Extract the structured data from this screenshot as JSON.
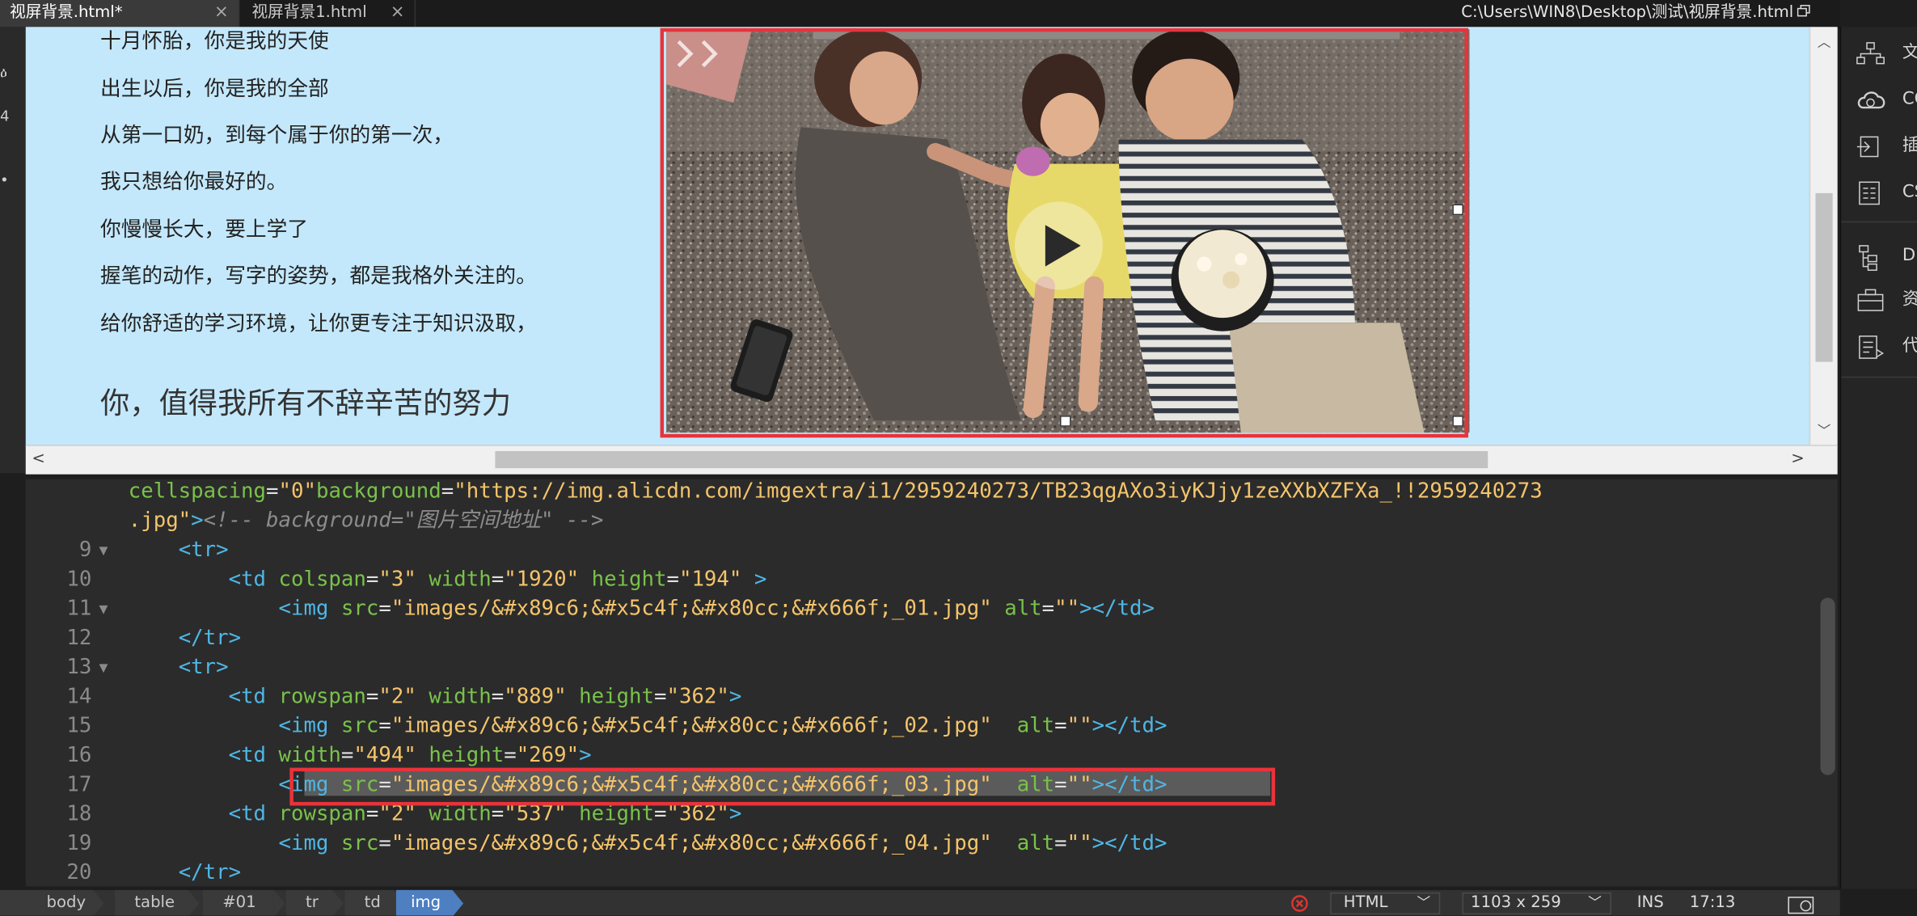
{
  "tabs": [
    {
      "label": "视屏背景.html*",
      "close": "×"
    },
    {
      "label": "视屏背景1.html",
      "close": "×"
    }
  ],
  "file_path": "C:\\Users\\WIN8\\Desktop\\测试\\视屏背景.html",
  "left_strip": {
    "glyphs": [
      "ዕ",
      "4",
      "•"
    ]
  },
  "design": {
    "poem_lines": [
      "十月怀胎，你是我的天使",
      "出生以后，你是我的全部",
      "从第一口奶，到每个属于你的第一次，",
      "我只想给你最好的。",
      "你慢慢长大，要上学了",
      "握笔的动作，写字的姿势，都是我格外关注的。",
      "给你舒适的学习环境，让你更专注于知识汲取，"
    ],
    "headline": "你，值得我所有不辞辛苦的努力",
    "image": {
      "subject": "family-on-sofa-photo",
      "play_icon": "play-icon"
    }
  },
  "right_panel": {
    "items": [
      {
        "label": "文",
        "icon": "files-tree-icon"
      },
      {
        "label": "CC",
        "icon": "creative-cloud-icon"
      },
      {
        "label": "插",
        "icon": "insert-icon"
      },
      {
        "label": "CS",
        "icon": "css-designer-icon"
      },
      {
        "label": "D",
        "icon": "dom-icon"
      },
      {
        "label": "资",
        "icon": "assets-icon"
      },
      {
        "label": "代",
        "icon": "snippets-icon"
      }
    ]
  },
  "code": {
    "lines": [
      {
        "num": "",
        "fold": false,
        "segments": [
          [
            "attr",
            "cellspacing"
          ],
          [
            "txt",
            "="
          ],
          [
            "val",
            "\"0\""
          ],
          [
            "attr",
            "background"
          ],
          [
            "txt",
            "="
          ],
          [
            "val",
            "\"https://img.alicdn.com/imgextra/i1/2959240273/TB23qgAXo3iyKJjy1zeXXbXZFXa_!!2959240273"
          ]
        ]
      },
      {
        "num": "",
        "fold": false,
        "segments": [
          [
            "val",
            ".jpg\""
          ],
          [
            "tag",
            ">"
          ],
          [
            "cmt",
            "<!-- background=\"图片空间地址\" -->"
          ]
        ]
      },
      {
        "num": "9",
        "fold": true,
        "segments": [
          [
            "txt",
            "    "
          ],
          [
            "tag",
            "<tr>"
          ]
        ]
      },
      {
        "num": "10",
        "fold": false,
        "segments": [
          [
            "txt",
            "        "
          ],
          [
            "tag",
            "<td "
          ],
          [
            "attr",
            "colspan"
          ],
          [
            "txt",
            "="
          ],
          [
            "val",
            "\"3\""
          ],
          [
            "txt",
            " "
          ],
          [
            "attr",
            "width"
          ],
          [
            "txt",
            "="
          ],
          [
            "val",
            "\"1920\""
          ],
          [
            "txt",
            " "
          ],
          [
            "attr",
            "height"
          ],
          [
            "txt",
            "="
          ],
          [
            "val",
            "\"194\""
          ],
          [
            "txt",
            " "
          ],
          [
            "tag",
            ">"
          ]
        ]
      },
      {
        "num": "11",
        "fold": true,
        "segments": [
          [
            "txt",
            "            "
          ],
          [
            "tag",
            "<img "
          ],
          [
            "attr",
            "src"
          ],
          [
            "txt",
            "="
          ],
          [
            "val",
            "\"images/&#x89c6;&#x5c4f;&#x80cc;&#x666f;_01.jpg\""
          ],
          [
            "txt",
            " "
          ],
          [
            "attr",
            "alt"
          ],
          [
            "txt",
            "="
          ],
          [
            "val",
            "\"\""
          ],
          [
            "tag",
            "></td>"
          ]
        ]
      },
      {
        "num": "12",
        "fold": false,
        "segments": [
          [
            "txt",
            "    "
          ],
          [
            "tag",
            "</tr>"
          ]
        ]
      },
      {
        "num": "13",
        "fold": true,
        "segments": [
          [
            "txt",
            "    "
          ],
          [
            "tag",
            "<tr>"
          ]
        ]
      },
      {
        "num": "14",
        "fold": false,
        "segments": [
          [
            "txt",
            "        "
          ],
          [
            "tag",
            "<td "
          ],
          [
            "attr",
            "rowspan"
          ],
          [
            "txt",
            "="
          ],
          [
            "val",
            "\"2\""
          ],
          [
            "txt",
            " "
          ],
          [
            "attr",
            "width"
          ],
          [
            "txt",
            "="
          ],
          [
            "val",
            "\"889\""
          ],
          [
            "txt",
            " "
          ],
          [
            "attr",
            "height"
          ],
          [
            "txt",
            "="
          ],
          [
            "val",
            "\"362\""
          ],
          [
            "tag",
            ">"
          ]
        ]
      },
      {
        "num": "15",
        "fold": false,
        "segments": [
          [
            "txt",
            "            "
          ],
          [
            "tag",
            "<img "
          ],
          [
            "attr",
            "src"
          ],
          [
            "txt",
            "="
          ],
          [
            "val",
            "\"images/&#x89c6;&#x5c4f;&#x80cc;&#x666f;_02.jpg\""
          ],
          [
            "txt",
            "  "
          ],
          [
            "attr",
            "alt"
          ],
          [
            "txt",
            "="
          ],
          [
            "val",
            "\"\""
          ],
          [
            "tag",
            "></td>"
          ]
        ]
      },
      {
        "num": "16",
        "fold": false,
        "segments": [
          [
            "txt",
            "        "
          ],
          [
            "tag",
            "<td "
          ],
          [
            "attr",
            "width"
          ],
          [
            "txt",
            "="
          ],
          [
            "val",
            "\"494\""
          ],
          [
            "txt",
            " "
          ],
          [
            "attr",
            "height"
          ],
          [
            "txt",
            "="
          ],
          [
            "val",
            "\"269\""
          ],
          [
            "tag",
            ">"
          ]
        ]
      },
      {
        "num": "17",
        "fold": false,
        "segments": [
          [
            "txt",
            "            "
          ],
          [
            "tag",
            "<img "
          ],
          [
            "attr",
            "src"
          ],
          [
            "txt",
            "="
          ],
          [
            "val",
            "\"images/&#x89c6;&#x5c4f;&#x80cc;&#x666f;_03.jpg\""
          ],
          [
            "txt",
            "  "
          ],
          [
            "attr",
            "alt"
          ],
          [
            "txt",
            "="
          ],
          [
            "val",
            "\"\""
          ],
          [
            "tag",
            "></td>"
          ]
        ]
      },
      {
        "num": "18",
        "fold": false,
        "segments": [
          [
            "txt",
            "        "
          ],
          [
            "tag",
            "<td "
          ],
          [
            "attr",
            "rowspan"
          ],
          [
            "txt",
            "="
          ],
          [
            "val",
            "\"2\""
          ],
          [
            "txt",
            " "
          ],
          [
            "attr",
            "width"
          ],
          [
            "txt",
            "="
          ],
          [
            "val",
            "\"537\""
          ],
          [
            "txt",
            " "
          ],
          [
            "attr",
            "height"
          ],
          [
            "txt",
            "="
          ],
          [
            "val",
            "\"362\""
          ],
          [
            "tag",
            ">"
          ]
        ]
      },
      {
        "num": "19",
        "fold": false,
        "segments": [
          [
            "txt",
            "            "
          ],
          [
            "tag",
            "<img "
          ],
          [
            "attr",
            "src"
          ],
          [
            "txt",
            "="
          ],
          [
            "val",
            "\"images/&#x89c6;&#x5c4f;&#x80cc;&#x666f;_04.jpg\""
          ],
          [
            "txt",
            "  "
          ],
          [
            "attr",
            "alt"
          ],
          [
            "txt",
            "="
          ],
          [
            "val",
            "\"\""
          ],
          [
            "tag",
            "></td>"
          ]
        ]
      },
      {
        "num": "20",
        "fold": false,
        "segments": [
          [
            "txt",
            "    "
          ],
          [
            "tag",
            "</tr>"
          ]
        ]
      }
    ]
  },
  "status_bar": {
    "breadcrumbs": [
      "body",
      "table",
      "#01",
      "tr",
      "td",
      "img"
    ],
    "error_icon": "error-icon",
    "doc_type": "HTML",
    "doc_size": "1103 x 259",
    "insert_mode": "INS",
    "cursor_pos": "17:13",
    "preview_icon": "preview-icon"
  },
  "colors": {
    "accent": "#4d7fc1",
    "design_bg": "#c4e8fb",
    "highlight_red": "#e8333a",
    "code_tag": "#4fb6e5",
    "code_attr": "#79c24a",
    "code_value": "#f5c46b"
  }
}
